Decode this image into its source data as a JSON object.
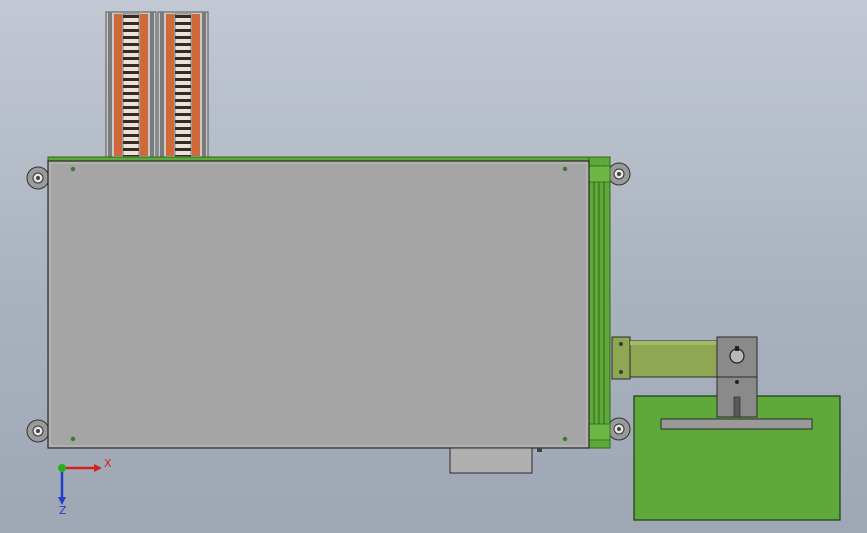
{
  "viewport": {
    "background_top": "#c2c9d4",
    "background_bottom": "#9ea7b3"
  },
  "colors": {
    "panel_gray": "#a5a5a5",
    "frame_green": "#5fa83a",
    "frame_green_dark": "#2f6a1a",
    "bracket_olive": "#8fa653",
    "stack_orange": "#d0693a",
    "mount_gray": "#8a8a8a",
    "axis_x": "#d42020",
    "axis_y": "#22b022",
    "axis_z": "#2040c8"
  },
  "triad": {
    "x_label": "X",
    "z_label": "Z",
    "icon": "coordinate-triad-icon"
  },
  "components": {
    "stacks": 2,
    "stack_slices": 20,
    "corner_mounts": 4
  }
}
